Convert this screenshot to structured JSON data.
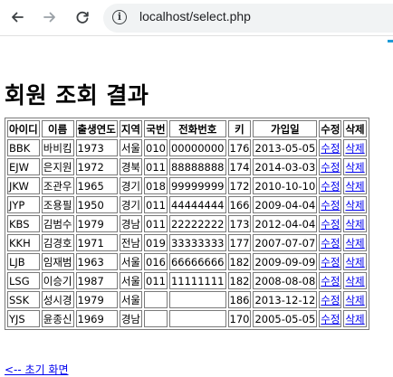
{
  "browser": {
    "url": "localhost/select.php"
  },
  "page": {
    "title": "회원 조회 결과",
    "columns": [
      "아이디",
      "이름",
      "출생연도",
      "지역",
      "국번",
      "전화번호",
      "키",
      "가입일",
      "수정",
      "삭제"
    ],
    "rows": [
      {
        "id": "BBK",
        "name": "바비킴",
        "year": "1973",
        "region": "서울",
        "prefix": "010",
        "phone": "00000000",
        "height": "176",
        "joined": "2013-05-05",
        "edit": "수정",
        "delete": "삭제"
      },
      {
        "id": "EJW",
        "name": "은지원",
        "year": "1972",
        "region": "경북",
        "prefix": "011",
        "phone": "88888888",
        "height": "174",
        "joined": "2014-03-03",
        "edit": "수정",
        "delete": "삭제"
      },
      {
        "id": "JKW",
        "name": "조관우",
        "year": "1965",
        "region": "경기",
        "prefix": "018",
        "phone": "99999999",
        "height": "172",
        "joined": "2010-10-10",
        "edit": "수정",
        "delete": "삭제"
      },
      {
        "id": "JYP",
        "name": "조용필",
        "year": "1950",
        "region": "경기",
        "prefix": "011",
        "phone": "44444444",
        "height": "166",
        "joined": "2009-04-04",
        "edit": "수정",
        "delete": "삭제"
      },
      {
        "id": "KBS",
        "name": "김범수",
        "year": "1979",
        "region": "경남",
        "prefix": "011",
        "phone": "22222222",
        "height": "173",
        "joined": "2012-04-04",
        "edit": "수정",
        "delete": "삭제"
      },
      {
        "id": "KKH",
        "name": "김경호",
        "year": "1971",
        "region": "전남",
        "prefix": "019",
        "phone": "33333333",
        "height": "177",
        "joined": "2007-07-07",
        "edit": "수정",
        "delete": "삭제"
      },
      {
        "id": "LJB",
        "name": "임재범",
        "year": "1963",
        "region": "서울",
        "prefix": "016",
        "phone": "66666666",
        "height": "182",
        "joined": "2009-09-09",
        "edit": "수정",
        "delete": "삭제"
      },
      {
        "id": "LSG",
        "name": "이승기",
        "year": "1987",
        "region": "서울",
        "prefix": "011",
        "phone": "11111111",
        "height": "182",
        "joined": "2008-08-08",
        "edit": "수정",
        "delete": "삭제"
      },
      {
        "id": "SSK",
        "name": "성시경",
        "year": "1979",
        "region": "서울",
        "prefix": "",
        "phone": "",
        "height": "186",
        "joined": "2013-12-12",
        "edit": "수정",
        "delete": "삭제"
      },
      {
        "id": "YJS",
        "name": "윤종신",
        "year": "1969",
        "region": "경남",
        "prefix": "",
        "phone": "",
        "height": "170",
        "joined": "2005-05-05",
        "edit": "수정",
        "delete": "삭제"
      }
    ],
    "back_link": "<-- 초기 화면"
  }
}
